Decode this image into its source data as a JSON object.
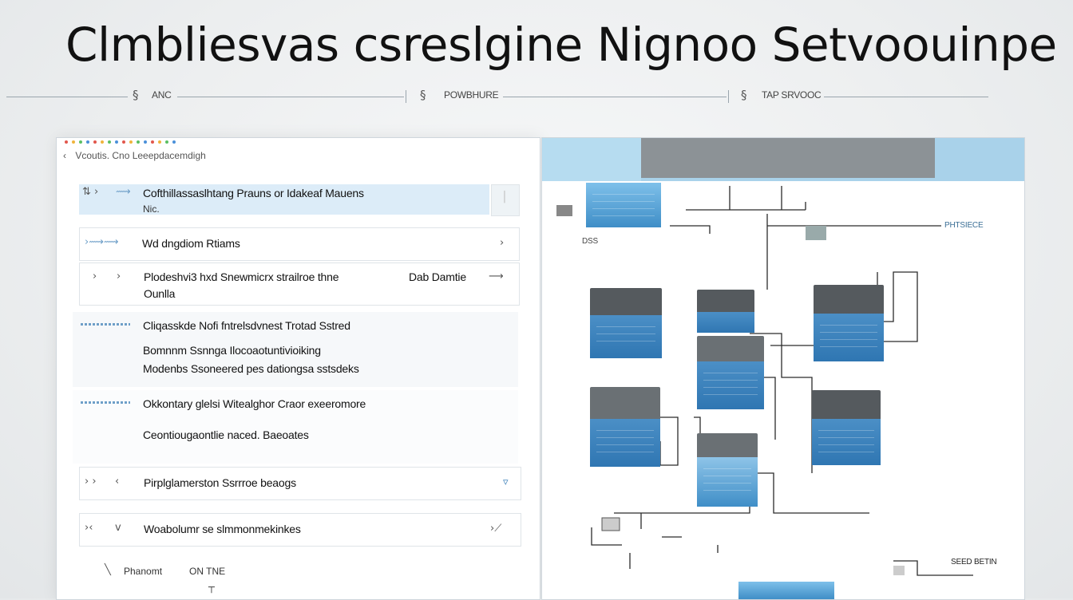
{
  "title": "Clmbliesvas csreslgine Nignoo Setvoouinpe",
  "subheader": {
    "item1": "ANC",
    "item2": "POWBHURE",
    "item3": "TAP SRVOOC",
    "edge_faint": ""
  },
  "breadcrumb": {
    "back_icon": "back-arrow",
    "text": "Vcoutis. Cno Leeepdacemdigh"
  },
  "window_dots": [
    "#e2574c",
    "#f0b43c",
    "#5bbf63",
    "#4a90d9",
    "#e2574c",
    "#f0b43c",
    "#5bbf63",
    "#4a90d9",
    "#e2574c",
    "#f0b43c",
    "#5bbf63",
    "#4a90d9",
    "#e2574c",
    "#f0b43c",
    "#5bbf63",
    "#4a90d9"
  ],
  "list": [
    {
      "title": "Cofthillassaslhtang Prauns or Idakeaf Mauens",
      "sub": "Nic."
    },
    {
      "title": "Wd dngdiom Rtiams"
    },
    {
      "title": "Plodeshvi3 hxd Snewmicrx strailroe thne",
      "sub": "Ounlla",
      "right_label": "Dab Damtie"
    },
    {
      "title": "Cliqasskde Nofi fntrelsdvnest Trotad Sstred",
      "line2": "Bomnnm Ssnnga Ilocoaotuntivioiking",
      "line3": "Modenbs Ssoneered pes dationgsa sstsdeks"
    },
    {
      "title": "Okkontary glelsi Witealghor Craor exeeromore",
      "line2": "Ceontiougaontlie naced. Baeoates"
    },
    {
      "title": "Pirplglamerston Ssrrroe beaogs"
    },
    {
      "title": "Woabolumr se slmmonmekinkes"
    }
  ],
  "footer": {
    "left": "Phanomt",
    "right": "ON TNE"
  },
  "diagram": {
    "label_top_right": "PHTSIECE",
    "label_bottom_right": "SEED BETIN",
    "label_left": "DSS"
  },
  "colors": {
    "accent": "#2f76b2",
    "header_bar": "#a9d2ea",
    "cap": "#555a5e",
    "selected_row": "#dcecf8"
  }
}
